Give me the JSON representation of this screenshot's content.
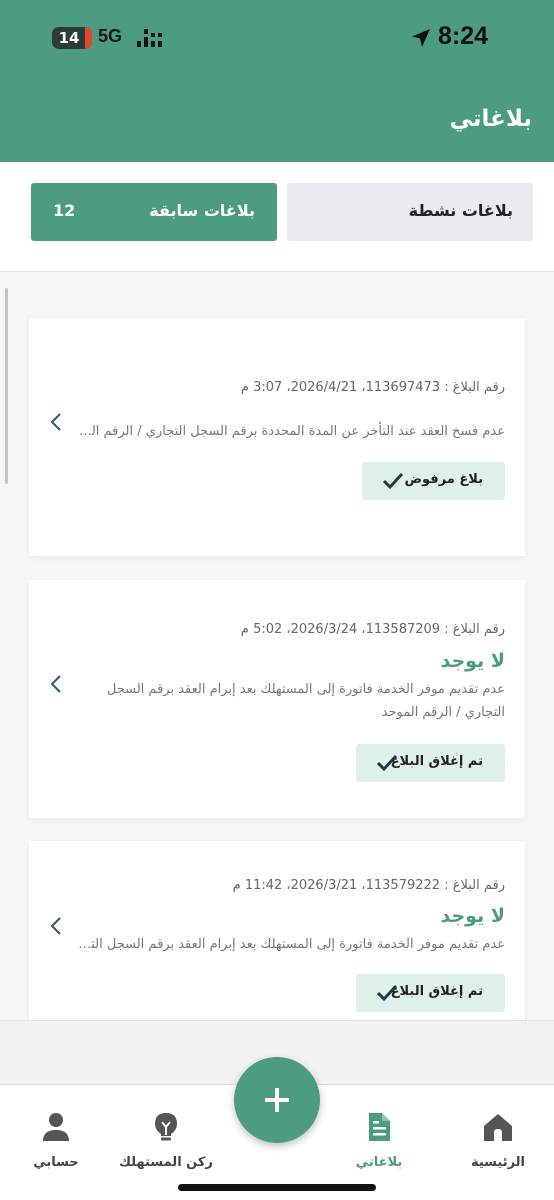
{
  "status_bar": {
    "time": "8:24",
    "battery": "14",
    "network": "5G"
  },
  "header": {
    "title": "بلاغاتي"
  },
  "tabs": {
    "active_label": "بلاغات نشطة",
    "previous_label": "بلاغات سابقة",
    "previous_count": "12"
  },
  "reports": [
    {
      "meta": "رقم البلاغ : 113697473، 2026/4/21، 3:07 م",
      "heading": "",
      "description": "عدم فسخ العقد عند التأخر عن المدة المحددة برقم السجل التجاري / الرقم الموحد",
      "status": "بلاغ مرفوض"
    },
    {
      "meta": "رقم البلاغ : 113587209، 2026/3/24، 5:02 م",
      "heading": "لا يوجد",
      "description": "عدم تقديم موفر الخدمة فاتورة إلى المستهلك بعد إبرام العقد برقم السجل التجاري / الرقم الموحد",
      "status": "تم إغلاق البلاغ"
    },
    {
      "meta": "رقم البلاغ : 113579222، 2026/3/21، 11:42 م",
      "heading": "لا يوجد",
      "description": "عدم تقديم موفر الخدمة فاتورة إلى المستهلك بعد إبرام العقد برقم السجل التجا...",
      "status": "تم إغلاق البلاغ"
    }
  ],
  "bottom_nav": {
    "home": "الرئيسية",
    "reports": "بلاغاتي",
    "consumer_corner": "ركن المستهلك",
    "account": "حسابي"
  },
  "colors": {
    "primary": "#4c9c82",
    "status_bg": "#dff0e9"
  }
}
